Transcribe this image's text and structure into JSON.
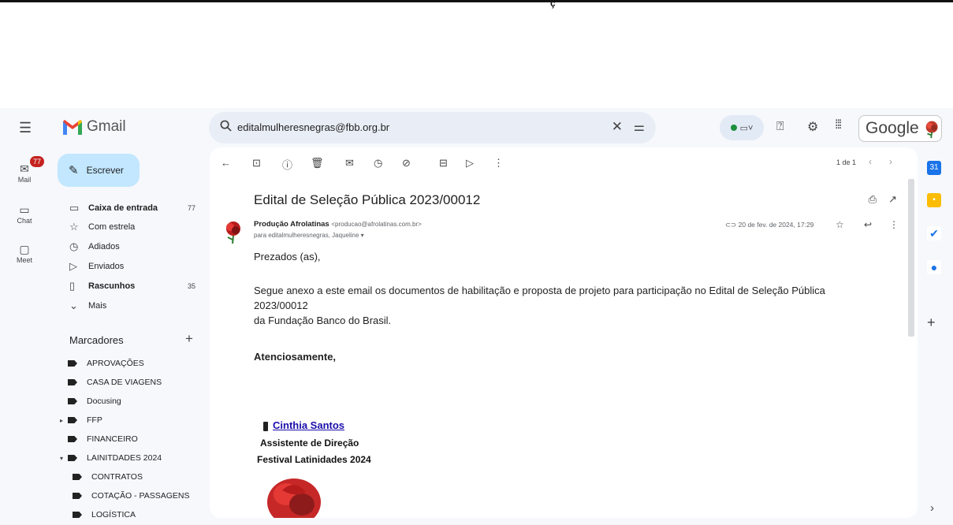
{
  "page": {
    "stray_char": "ç"
  },
  "header": {
    "app_name": "Gmail",
    "search_value": "editalmulheresnegras@fbb.org.br",
    "status_label": "▭˅",
    "account_brand": "Google"
  },
  "rail": {
    "items": [
      {
        "label": "Mail",
        "icon": "mail-icon"
      },
      {
        "label": "Chat",
        "icon": "chat-icon"
      },
      {
        "label": "Meet",
        "icon": "meet-icon"
      }
    ],
    "mail_badge": "77"
  },
  "sidebar": {
    "compose_label": "Escrever",
    "folders": [
      {
        "label": "Caixa de entrada",
        "count": "77",
        "bold": true,
        "icon": "inbox-icon"
      },
      {
        "label": "Com estrela",
        "count": "",
        "bold": false,
        "icon": "star-icon"
      },
      {
        "label": "Adiados",
        "count": "",
        "bold": false,
        "icon": "clock-icon"
      },
      {
        "label": "Enviados",
        "count": "",
        "bold": false,
        "icon": "send-icon"
      },
      {
        "label": "Rascunhos",
        "count": "35",
        "bold": true,
        "icon": "draft-icon"
      },
      {
        "label": "Mais",
        "count": "",
        "bold": false,
        "icon": "chevron-down-icon"
      }
    ],
    "labels_title": "Marcadores",
    "labels": [
      {
        "label": "APROVAÇÕES",
        "caret": "",
        "indent": false
      },
      {
        "label": "CASA DE VIAGENS",
        "caret": "",
        "indent": false
      },
      {
        "label": "Docusing",
        "caret": "",
        "indent": false
      },
      {
        "label": "FFP",
        "caret": "▸",
        "indent": false
      },
      {
        "label": "FINANCEIRO",
        "caret": "",
        "indent": false
      },
      {
        "label": "LAINITDADES 2024",
        "caret": "▾",
        "indent": false
      },
      {
        "label": "CONTRATOS",
        "caret": "",
        "indent": true
      },
      {
        "label": "COTAÇÃO - PASSAGENS",
        "caret": "",
        "indent": true
      },
      {
        "label": "LOGÍSTICA",
        "caret": "",
        "indent": true
      }
    ]
  },
  "message": {
    "pager": "1 de 1",
    "subject": "Edital de Seleção Pública 2023/00012",
    "sender_name": "Produção Afrolatinas",
    "sender_email": "<producao@afrolatinas.com.br>",
    "recipients": "para editalmulheresnegras, Jaqueline",
    "date": "20 de fev. de 2024, 17:29",
    "greeting": "Prezados (as),",
    "body_line1": "Segue anexo a este email os documentos de habilitação e proposta de projeto para participação no Edital de Seleção Pública",
    "body_line2": "2023/00012",
    "body_line3": "da Fundação Banco do Brasil.",
    "closing": "Atenciosamente,",
    "sig_name": "Cinthia Santos",
    "sig_role": "Assistente de Direção",
    "sig_org": "Festival Latinidades 2024"
  },
  "colors": {
    "compose_bg": "#c2e7ff",
    "search_bg": "#e9eef6",
    "badge": "#c5221f",
    "link": "#1a0dab"
  }
}
